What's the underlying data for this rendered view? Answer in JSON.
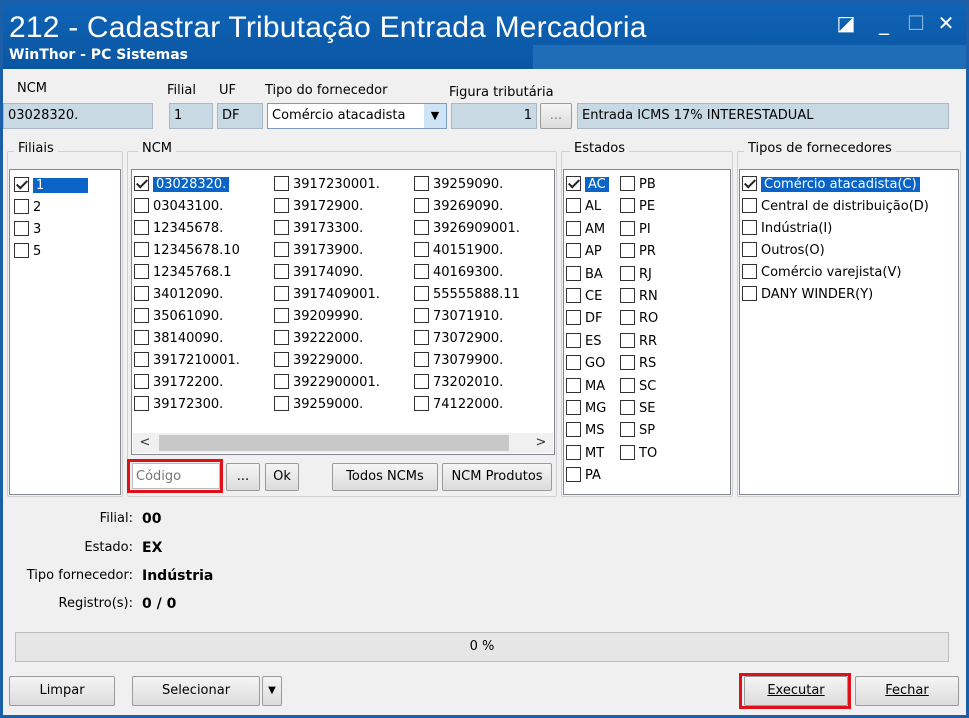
{
  "window": {
    "title": "212 - Cadastrar Tributação Entrada Mercadoria",
    "subtitle": "WinThor - PC Sistemas",
    "controls": {
      "restore": "◪",
      "minimize": "_",
      "maximize": "☐",
      "close": "✕"
    }
  },
  "header": {
    "ncm_label": "NCM",
    "ncm_value": "03028320.",
    "filial_label": "Filial",
    "filial_value": "1",
    "uf_label": "UF",
    "uf_value": "DF",
    "tipo_fornecedor_label": "Tipo do fornecedor",
    "tipo_fornecedor_value": "Comércio atacadista",
    "figura_label": "Figura tributária",
    "figura_value": "1",
    "figura_button": "...",
    "figura_desc": "Entrada ICMS 17% INTERESTADUAL"
  },
  "filiais": {
    "title": "Filiais",
    "items": [
      {
        "label": "1",
        "checked": true,
        "selected": true
      },
      {
        "label": "2",
        "checked": false,
        "selected": false
      },
      {
        "label": "3",
        "checked": false,
        "selected": false
      },
      {
        "label": "5",
        "checked": false,
        "selected": false
      }
    ]
  },
  "ncm": {
    "title": "NCM",
    "columns": [
      [
        "03028320.",
        "03043100.",
        "12345678.",
        "12345678.10",
        "12345768.1",
        "34012090.",
        "35061090.",
        "38140090.",
        "3917210001.",
        "39172200.",
        "39172300."
      ],
      [
        "3917230001.",
        "39172900.",
        "39173300.",
        "39173900.",
        "39174090.",
        "3917409001.",
        "39209990.",
        "39222000.",
        "39229000.",
        "3922900001.",
        "39259000."
      ],
      [
        "39259090.",
        "39269090.",
        "3926909001.",
        "40151900.",
        "40169300.",
        "55555888.11",
        "73071910.",
        "73072900.",
        "73079900.",
        "73202010.",
        "74122000."
      ]
    ],
    "checked": "03028320.",
    "codigo_placeholder": "Código",
    "dots_button": "...",
    "ok_button": "Ok",
    "todos_button": "Todos NCMs",
    "produtos_button": "NCM Produtos",
    "scroll_left": "<",
    "scroll_right": ">"
  },
  "estados": {
    "title": "Estados",
    "left": [
      "AC",
      "AL",
      "AM",
      "AP",
      "BA",
      "CE",
      "DF",
      "ES",
      "GO",
      "MA",
      "MG",
      "MS",
      "MT",
      "PA"
    ],
    "right": [
      "PB",
      "PE",
      "PI",
      "PR",
      "RJ",
      "RN",
      "RO",
      "RR",
      "RS",
      "SC",
      "SE",
      "SP",
      "TO"
    ],
    "checked": "AC"
  },
  "tipos": {
    "title": "Tipos de fornecedores",
    "items": [
      {
        "label": "Comércio atacadista(C)",
        "checked": true,
        "selected": true
      },
      {
        "label": "Central de distribuição(D)",
        "checked": false,
        "selected": false
      },
      {
        "label": "Indústria(I)",
        "checked": false,
        "selected": false
      },
      {
        "label": "Outros(O)",
        "checked": false,
        "selected": false
      },
      {
        "label": "Comércio varejista(V)",
        "checked": false,
        "selected": false
      },
      {
        "label": "DANY WINDER(Y)",
        "checked": false,
        "selected": false
      }
    ]
  },
  "info": {
    "filial_label": "Filial:",
    "filial_value": "00",
    "estado_label": "Estado:",
    "estado_value": "EX",
    "tipo_label": "Tipo fornecedor:",
    "tipo_value": "Indústria",
    "registros_label": "Registro(s):",
    "registros_value": "0 / 0"
  },
  "progress": {
    "text": "0 %",
    "value": 0
  },
  "footer": {
    "limpar": "Limpar",
    "selecionar": "Selecionar",
    "selecionar_arrow": "▼",
    "executar": "Executar",
    "fechar": "Fechar"
  }
}
